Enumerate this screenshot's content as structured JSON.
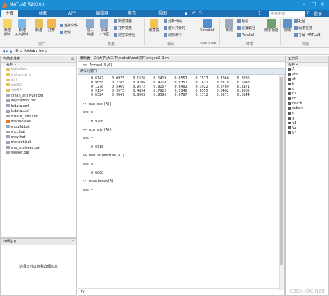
{
  "window": {
    "title": "MATLAB R2020b"
  },
  "tabs": [
    "主页",
    "绘图",
    "APP",
    "编辑器",
    "发布",
    "视图"
  ],
  "search": {
    "placeholder": "搜索文档"
  },
  "account": "登录",
  "ribbon": {
    "buttons": {
      "new_script": "新建\n脚本",
      "new_live": "新建\n实时脚本",
      "new": "新建",
      "open": "打开",
      "import": "导入\n数据",
      "save_ws": "保存\n工作区",
      "fav": "收藏夹",
      "analyze": "Simulink",
      "layout": "布局",
      "addons": "附加功能",
      "help": "帮助"
    },
    "small": {
      "find_files": "查找文件",
      "compare": "比较",
      "new_var": "新建变量",
      "open_var": "打开变量",
      "clear_ws": "清空工作区",
      "analyze_code": "分析代码",
      "run_time": "运行并计时",
      "clear_cmd": "清除命令",
      "preferences": "预设",
      "set_path": "设置路径",
      "parallel": "Parallel",
      "community": "社区",
      "support": "请求支持",
      "learn": "了解 MATLAB"
    },
    "groups": [
      "文件",
      "变量",
      "代码",
      "SIMULINK",
      "环境",
      "资源"
    ]
  },
  "path": "D: ▸ Matlab ▸ bin ▸",
  "current_folder": {
    "title": "当前文件夹",
    "column": "名称 ▴",
    "items": [
      {
        "name": "icutzdata",
        "dim": true,
        "type": "folder"
      },
      {
        "name": "m3iregistry",
        "dim": true,
        "type": "folder"
      },
      {
        "name": "util",
        "dim": true,
        "type": "folder"
      },
      {
        "name": "win32",
        "dim": true,
        "type": "folder"
      },
      {
        "name": "win64",
        "dim": true,
        "type": "folder"
      },
      {
        "name": "crash_analyzer.cfg",
        "dim": false,
        "type": "file"
      },
      {
        "name": "deploytool.bat",
        "dim": false,
        "type": "file"
      },
      {
        "name": "lcdata.xml",
        "dim": false,
        "type": "file"
      },
      {
        "name": "lcdata.xsd",
        "dim": false,
        "type": "file"
      },
      {
        "name": "lcdata_utf8.xml",
        "dim": false,
        "type": "file"
      },
      {
        "name": "matlab.exe",
        "dim": false,
        "type": "exe"
      },
      {
        "name": "mbuild.bat",
        "dim": false,
        "type": "file"
      },
      {
        "name": "mcc.bat",
        "dim": false,
        "type": "file"
      },
      {
        "name": "mex.bat",
        "dim": false,
        "type": "file"
      },
      {
        "name": "mexext.bat",
        "dim": false,
        "type": "file"
      },
      {
        "name": "mw_mpiexec.bat",
        "dim": false,
        "type": "file"
      },
      {
        "name": "worker.bat",
        "dim": false,
        "type": "file"
      }
    ]
  },
  "details": {
    "title": "详细信息",
    "hint": "选择文件以查看详细信息"
  },
  "editor": {
    "title": "编辑器 - D:\\大学\\大二下\\matlab\\mat文件\\shiyan2_2.m",
    "peek": ">> A=rand(5,6)"
  },
  "command_window": {
    "title": "命令行窗口",
    "text": "\nA =\n\n    0.8147    0.0975    0.1576    0.1419    0.6557    0.7577    0.7060    0.8235\n    0.9058    0.2785    0.9706    0.4218    0.0357    0.7431    0.0318    0.6948\n    0.1270    0.5469    0.9572    0.9157    0.8491    0.3922    0.2769    0.3171\n    0.9134    0.9575    0.4854    0.7922    0.9340    0.6555    0.0462    0.9502\n    0.6324    0.9649    0.8003    0.9595    0.6787    0.1712    0.0971    0.0344\n\n>> max(max(A))\n\nans =\n\n    0.9706\n\n>> min(min(A))\n\nans =\n\n    0.0318\n\n>> median(median(A))\n\nans =\n\n    0.6868\n\n>> mean(mean(A))\n\nans =",
    "prompt": "fx"
  },
  "workspace": {
    "title": "工作区",
    "column": "名称 ▴",
    "vars": [
      "A",
      "ans",
      "ch",
      "k",
      "q",
      "q1",
      "qn",
      "revch",
      "subch",
      "x",
      "y",
      "y1",
      "y2",
      "y3"
    ]
  },
  "watermark": "CSDN @CINZE"
}
